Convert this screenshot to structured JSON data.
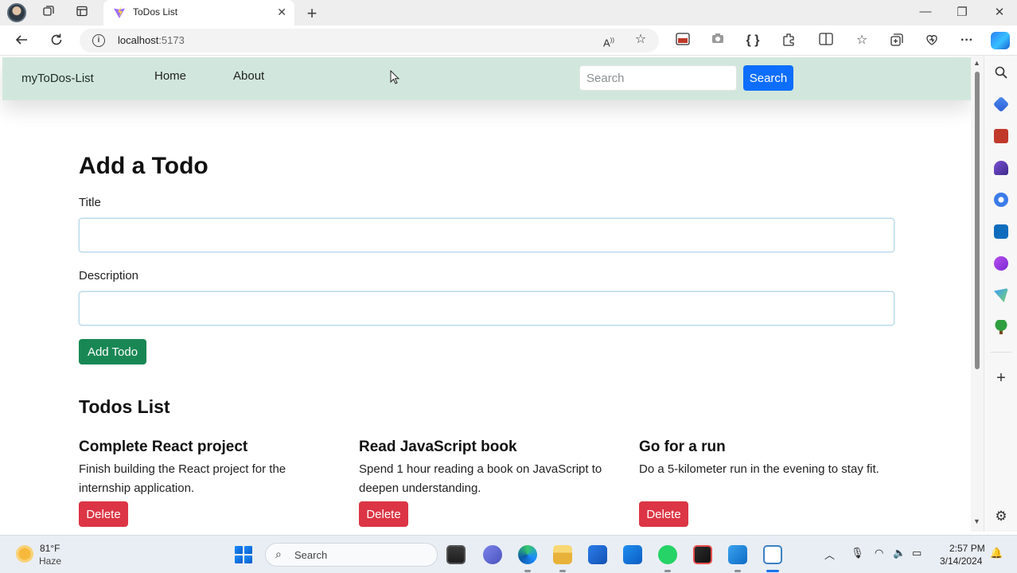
{
  "browser": {
    "tab_title": "ToDos List",
    "url_host": "localhost",
    "url_port": ":5173",
    "tab_close": "✕",
    "new_tab": "+"
  },
  "navbar": {
    "brand": "myToDos-List",
    "links": [
      "Home",
      "About"
    ],
    "search_placeholder": "Search",
    "search_button": "Search"
  },
  "form": {
    "heading": "Add a Todo",
    "title_label": "Title",
    "title_value": "",
    "description_label": "Description",
    "description_value": "",
    "submit_button": "Add Todo"
  },
  "todos": {
    "heading": "Todos List",
    "items": [
      {
        "title": "Complete React project",
        "description": "Finish building the React project for the internship application.",
        "delete_label": "Delete"
      },
      {
        "title": "Read JavaScript book",
        "description": "Spend 1 hour reading a book on JavaScript to deepen understanding.",
        "delete_label": "Delete"
      },
      {
        "title": "Go for a run",
        "description": "Do a 5-kilometer run in the evening to stay fit.",
        "delete_label": "Delete"
      }
    ]
  },
  "taskbar": {
    "weather_temp": "81°F",
    "weather_desc": "Haze",
    "search_label": "Search",
    "time": "2:57 PM",
    "date": "3/14/2024"
  },
  "colors": {
    "navbar_bg": "#d1e7dd",
    "primary": "#0d6efd",
    "success": "#198754",
    "danger": "#dc3545"
  }
}
